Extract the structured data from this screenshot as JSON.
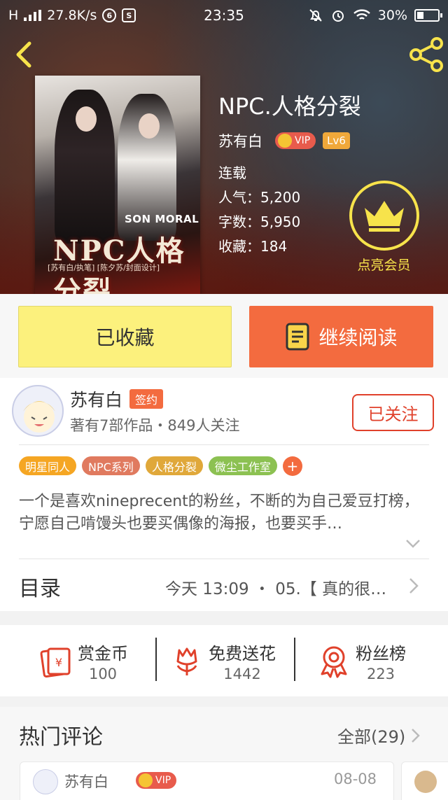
{
  "status_bar": {
    "network": "H",
    "speed": "27.8K/s",
    "time": "23:35",
    "battery": "30%"
  },
  "book": {
    "title": "NPC.人格分裂",
    "author": "苏有白",
    "vip_label": "VIP",
    "level": "Lv6",
    "status": "连载",
    "popularity": "人气：5,200",
    "word_count": "字数：5,950",
    "collections": "收藏：184",
    "cover": {
      "title": "NPC人格分裂",
      "subtitle": "SON MORAL",
      "credits": "[苏有白/执笔] [陈夕苏/封面设计]"
    }
  },
  "member": {
    "label": "点亮会员"
  },
  "actions": {
    "favorite_label": "已收藏",
    "read_label": "继续阅读"
  },
  "author_card": {
    "name": "苏有白",
    "sign_badge": "签约",
    "meta": "著有7部作品・849人关注",
    "follow_label": "已关注"
  },
  "tags": {
    "items": [
      "明星同人",
      "NPC系列",
      "人格分裂",
      "微尘工作室"
    ],
    "colors": [
      "#f5a623",
      "#e07a5f",
      "#e0a83a",
      "#8cc152"
    ],
    "add_label": "+"
  },
  "intro": {
    "text": "一个是喜欢nineprecent的粉丝，不断的为自己爱豆打榜，宁愿自己啃馒头也要买偶像的海报，也要买手…"
  },
  "toc": {
    "title": "目录",
    "latest": "今天 13:09 ・ 05.【 真的很…"
  },
  "stats": [
    {
      "label": "赏金币",
      "value": "100"
    },
    {
      "label": "免费送花",
      "value": "1442"
    },
    {
      "label": "粉丝榜",
      "value": "223"
    }
  ],
  "comments": {
    "title": "热门评论",
    "all_label": "全部(29)",
    "first": {
      "user": "苏有白",
      "vip": "VIP",
      "date": "08-08"
    }
  },
  "colors": {
    "accent": "#f36b3f",
    "favorite_bg": "#fcf17d",
    "member_yellow": "#f7e34b",
    "follow_red": "#e0412b",
    "stat_icon_red": "#e0412b"
  }
}
